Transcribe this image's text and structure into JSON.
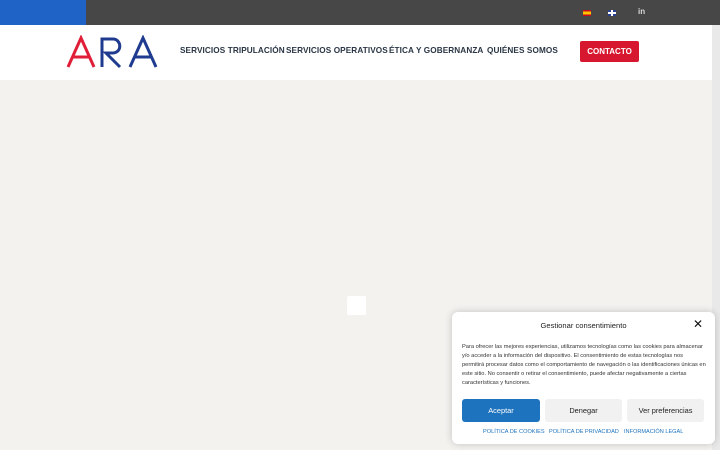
{
  "topbar": {
    "language_es": "Español",
    "language_en": "English",
    "linkedin_label": "in"
  },
  "header": {
    "logo_text": "ARA",
    "nav": [
      {
        "label": "SERVICIOS TRIPULACIÓN"
      },
      {
        "label": "SERVICIOS OPERATIVOS"
      },
      {
        "label": "ÉTICA Y GOBERNANZA"
      },
      {
        "label": "QUIÉNES SOMOS"
      }
    ],
    "contact_label": "CONTACTO"
  },
  "colors": {
    "brand_blue": "#1f63c6",
    "brand_red": "#d7172f",
    "topbar": "#474747"
  },
  "cookie_banner": {
    "title": "Gestionar consentimiento",
    "close_icon": "close-icon",
    "body": "Para ofrecer las mejores experiencias, utilizamos tecnologías como las cookies para almacenar y/o acceder a la información del dispositivo. El consentimiento de estas tecnologías nos permitirá procesar datos como el comportamiento de navegación o las identificaciones únicas en este sitio. No consentir o retirar el consentimiento, puede afectar negativamente a ciertas características y funciones.",
    "accept_label": "Aceptar",
    "deny_label": "Denegar",
    "prefs_label": "Ver preferencias",
    "links": [
      {
        "label": "POLÍTICA DE COOKIES"
      },
      {
        "label": "POLÍTICA DE PRIVACIDAD"
      },
      {
        "label": "INFORMACIÓN LEGAL"
      }
    ]
  }
}
